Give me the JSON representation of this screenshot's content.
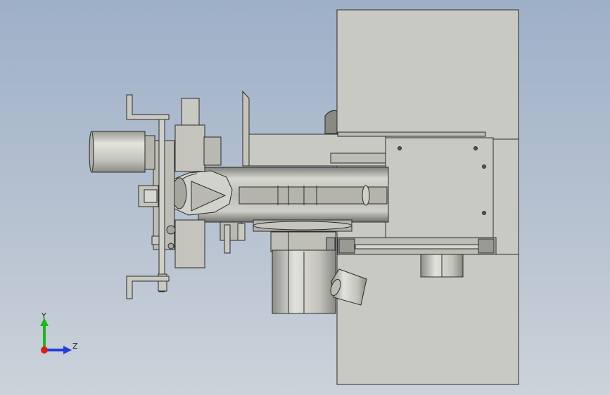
{
  "window": {
    "type": "cad-3d-viewport"
  },
  "model": {
    "description_icon": "assembly-model-icon",
    "colors": {
      "part_fill": "#c9c9c3",
      "part_fill_dark": "#a9a9a2",
      "edge": "#2a2a2a",
      "motor_light": "#d8d8d2",
      "background_top": "#9eb0c8",
      "background_bottom": "#ccd2da"
    }
  },
  "triad": {
    "y_label": "Y",
    "z_label": "Z",
    "colors": {
      "y": "#1fb51f",
      "z": "#1f3fd6",
      "x": "#d21f1f"
    }
  }
}
